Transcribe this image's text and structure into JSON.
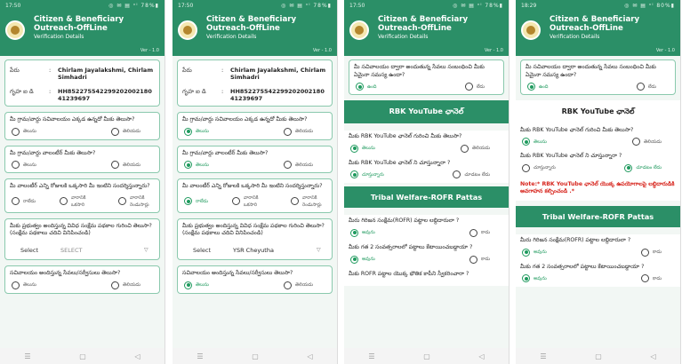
{
  "app": {
    "title_line1": "Citizen & Beneficiary",
    "title_line2": "Outreach-OffLine",
    "subtitle": "Verification Details",
    "version": "Ver - 1.0"
  },
  "colors": {
    "primary": "#2b8f67",
    "accent_radio": "#1f9a5e",
    "note": "#d7261e"
  },
  "labels": {
    "name": "పేరు",
    "household_id": "గృహ ఐ డి",
    "select": "Select",
    "yes": "ఉంది",
    "no": "లేదు",
    "knows": "తెలుసు",
    "not_knows": "తెలియదు",
    "got_it": "అవును",
    "no2": "కాదు",
    "watching": "చూస్తున్నారు",
    "not_watching": "చూడటం లేదు",
    "never": "రాలేదు",
    "once_week": "వారానికి ఒకసారి",
    "twice_week": "వారానికి రెండుసార్లు"
  },
  "citizen": {
    "name": "Chirlam Jayalakshmi, Chirlam Simhadri",
    "household_id": "HH85227554229920200218041239697"
  },
  "questions": {
    "q_sachivalayam_where": "మీ గ్రామ/వార్డు సచివాలయం ఎక్కడ ఉన్నదో మీకు తెలుసా?",
    "q_volunteer_known": "మీ గ్రామ/వార్డు వాలంటీర్ మీకు తెలుసా?",
    "q_volunteer_visit": "మీ వాలంటీర్ ఎన్ని రోజులకి ఒక్కసారి మీ ఇంటిని సందర్శిస్తున్నారు?",
    "q_schemes": "మీకు ప్రభుత్వం అందిస్తున్న వివిధ సంక్షేమ పథకాల గురించి తెలుసా? (సంక్షేమ పథకాలు చదివి వినిపించండి)",
    "q_services": "సచివాలయం అందిస్తున్న సేవలు/సర్వీసులు తెలుసా?",
    "q_services_problem": "మీ సచివాలయం ద్వారా అందుతున్న సేవలు సంబంధించి మీకు ఏమైనా సమస్య ఉందా?",
    "q_rbk_known": "మీకు RBK YouTube ఛానెల్ గురించి మీకు తెలుసా?",
    "q_rbk_watch": "మీకు RBK YouTube ఛానెల్ ని చూస్తున్నారా ?",
    "q_rofr_got": "మీరు గిరిజన సంక్షేమ(ROFR) పట్టాల లబ్దిదారులా ?",
    "q_rofr_years": "మీకు గత 2 సంవత్సరాలలో పట్టాలు కేటాయించబడ్డాయా ?",
    "q_rofr_copy": "మీకు ROFR పట్టాల యొక్క భౌతిక కాపీని స్వీకరించారా ?"
  },
  "sections": {
    "rbk": "RBK YouTube ఛానెల్",
    "tribal": "Tribal Welfare-ROFR Pattas"
  },
  "note_text": "Note:* RBK YouTube ఛానెల్ యొక్క ఉపయోగాలపై లబ్ధిదారుడికి అవగాహన కల్పించండి .*",
  "screens": [
    {
      "status_time": "17:50",
      "status_icons": "◎ ✉ ▤ ᵛᴵ 78%▮",
      "scheme_select": "SELECT"
    },
    {
      "status_time": "17:50",
      "status_icons": "◎ ✉ ▤ ᵛᴵ 78%▮",
      "scheme_select": "YSR Cheyutha"
    },
    {
      "status_time": "17:50",
      "status_icons": "◎ ✉ ▤ ᵛᴵ 78%▮"
    },
    {
      "status_time": "18:29",
      "status_icons": "◎ ✉ ▤ ᵛᴵ 80%▮"
    }
  ],
  "nav_icons": [
    "menu-icon",
    "home-icon",
    "back-icon"
  ]
}
